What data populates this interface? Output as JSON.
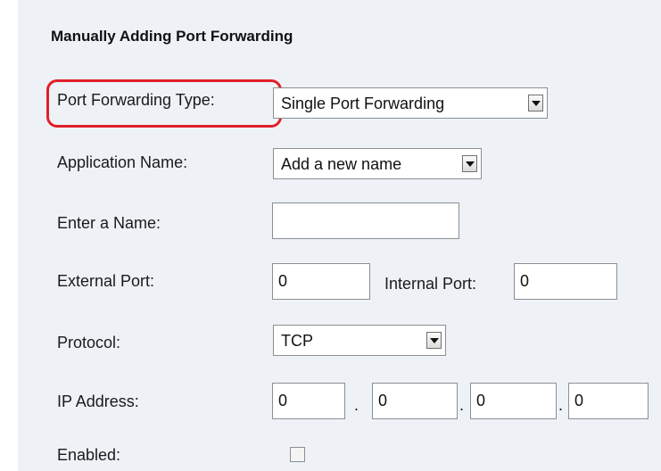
{
  "section_title": "Manually Adding Port Forwarding",
  "fields": {
    "forwarding_type": {
      "label": "Port Forwarding Type:",
      "value": "Single Port Forwarding"
    },
    "application_name": {
      "label": "Application Name:",
      "value": "Add a new name"
    },
    "enter_name": {
      "label": "Enter a Name:",
      "value": ""
    },
    "external_port": {
      "label": "External Port:",
      "value": "0"
    },
    "internal_port": {
      "label": "Internal Port:",
      "value": "0"
    },
    "protocol": {
      "label": "Protocol:",
      "value": "TCP"
    },
    "ip_address": {
      "label": "IP Address:",
      "octets": [
        "0",
        "0",
        "0",
        "0"
      ],
      "separator": "."
    },
    "enabled": {
      "label": "Enabled:",
      "checked": false
    }
  },
  "colors": {
    "panel_background": "#eef2f6",
    "highlight_ring": "#e0202a"
  },
  "icons": {
    "dropdown": "chevron-down-icon"
  }
}
